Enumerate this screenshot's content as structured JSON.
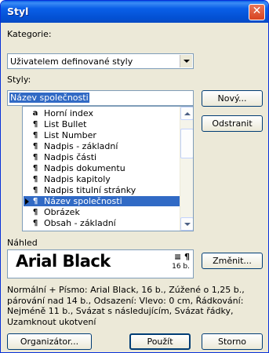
{
  "window": {
    "title": "Styl",
    "close_glyph": "✕"
  },
  "category": {
    "label": "Kategorie:",
    "selected": "Uživatelem definované styly"
  },
  "styles": {
    "label": "Styly:",
    "input_value": "Název společnosti",
    "items": [
      {
        "mark": "a",
        "label": "Horní index",
        "selected": false,
        "current": false
      },
      {
        "mark": "¶",
        "label": "List Bullet",
        "selected": false,
        "current": false
      },
      {
        "mark": "¶",
        "label": "List Number",
        "selected": false,
        "current": false
      },
      {
        "mark": "¶",
        "label": "Nadpis - základní",
        "selected": false,
        "current": false
      },
      {
        "mark": "¶",
        "label": "Nadpis části",
        "selected": false,
        "current": false
      },
      {
        "mark": "¶",
        "label": "Nadpis dokumentu",
        "selected": false,
        "current": false
      },
      {
        "mark": "¶",
        "label": "Nadpis kapitoly",
        "selected": false,
        "current": false
      },
      {
        "mark": "¶",
        "label": "Nadpis titulní stránky",
        "selected": false,
        "current": false
      },
      {
        "mark": "¶",
        "label": "Název společnosti",
        "selected": true,
        "current": true
      },
      {
        "mark": "¶",
        "label": "Obrázek",
        "selected": false,
        "current": false
      },
      {
        "mark": "¶",
        "label": "Obsah - základní",
        "selected": false,
        "current": false
      }
    ]
  },
  "buttons": {
    "new": "Nový...",
    "delete": "Odstranit",
    "modify": "Změnit...",
    "organizer": "Organizátor...",
    "apply": "Použít",
    "cancel": "Storno"
  },
  "preview": {
    "label": "Náhled",
    "sample_text": "Arial Black",
    "align_glyph": "≡ ¶",
    "size_text": "16 b."
  },
  "description": "Normální + Písmo: Arial Black, 16 b., Zúžené o  1,25 b., párování nad 14 b., Odsazení: Vlevo:  0 cm, Řádkování: Nejméně 11 b., Svázat s následujícím, Svázat řádky, Uzamknout ukotvení"
}
